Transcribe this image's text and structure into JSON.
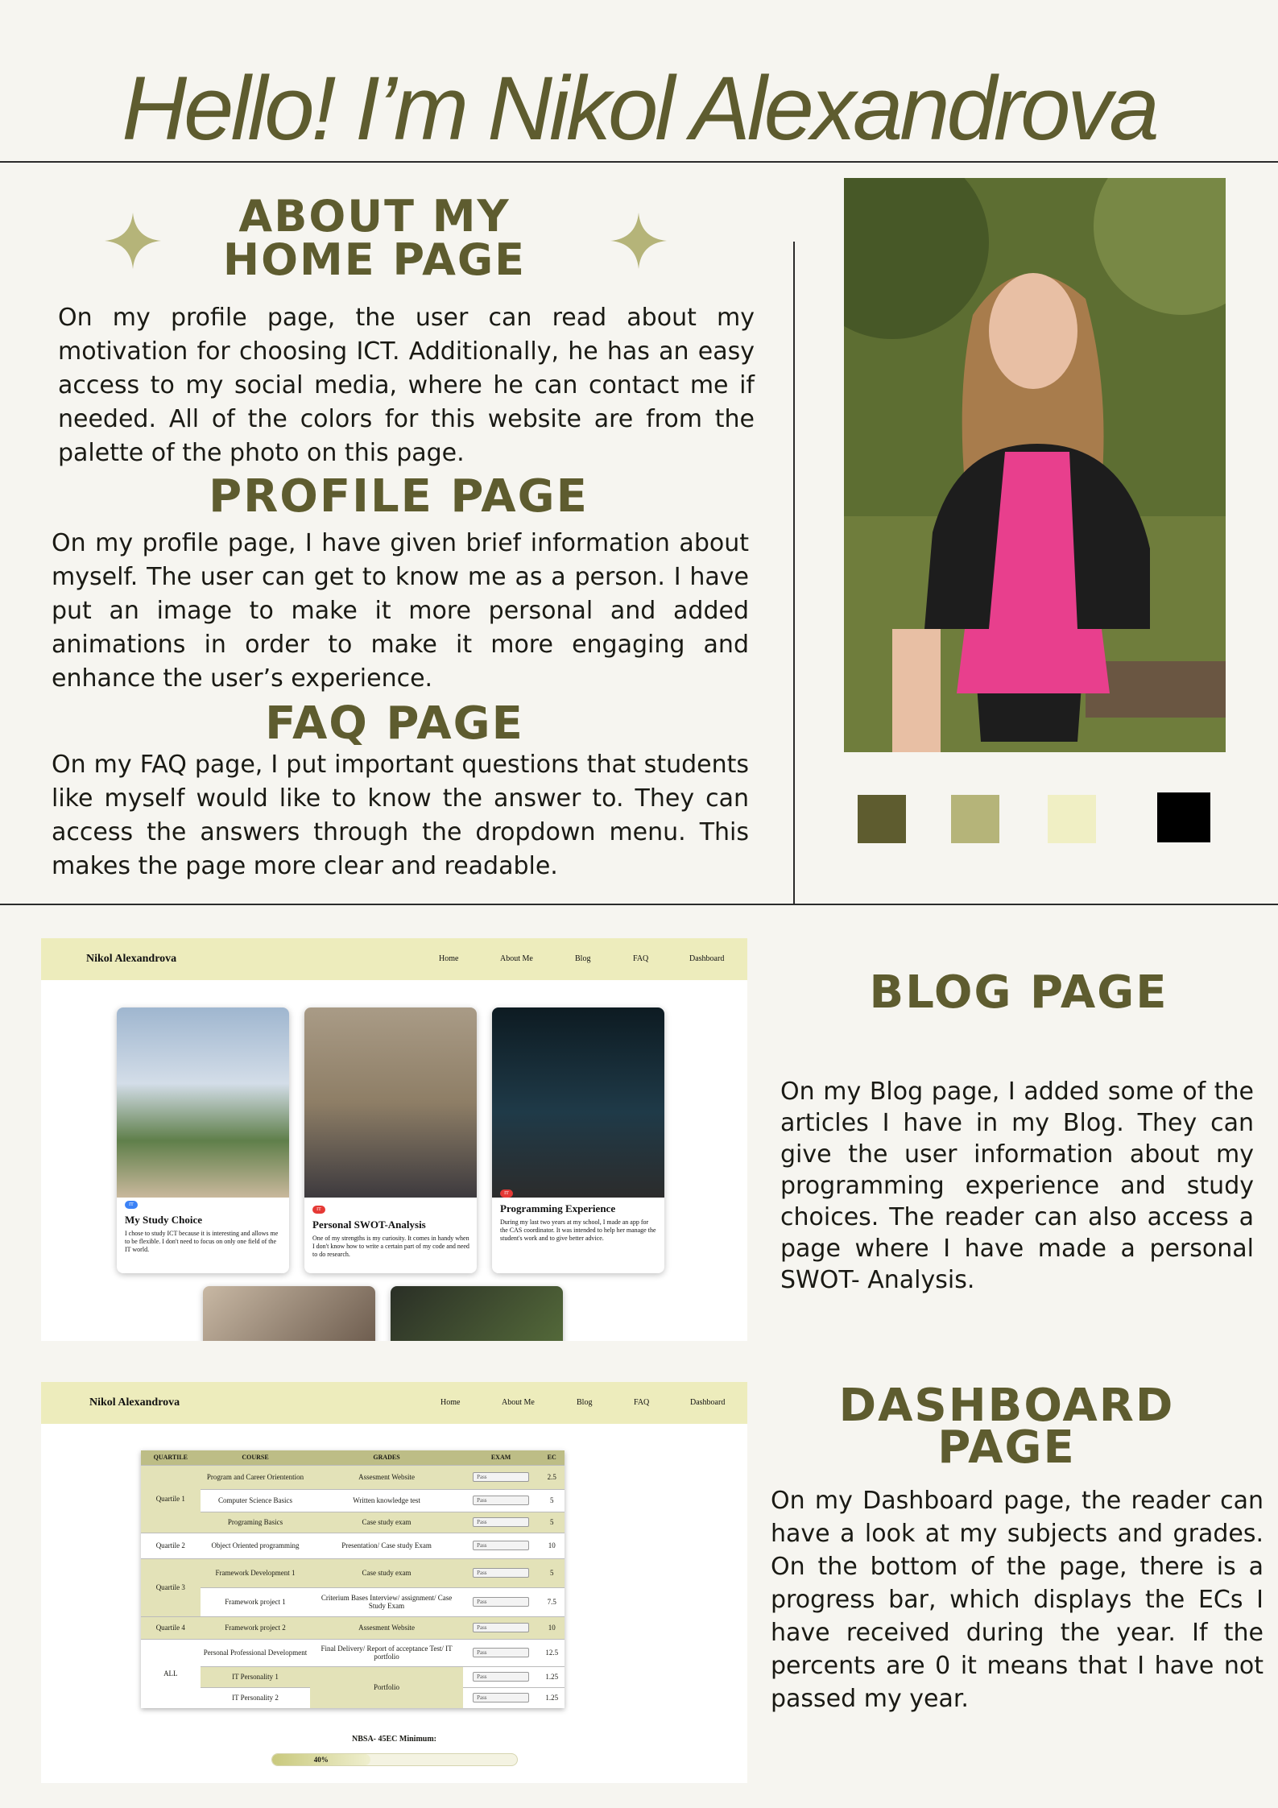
{
  "title": "Hello! I’m Nikol Alexandrova",
  "sections": {
    "about": {
      "heading_line1": "ABOUT MY",
      "heading_line2": "HOME PAGE",
      "text": "On my profile page, the user can read about my motivation for choosing ICT. Additionally, he has an easy access to my social media, where he can contact me if needed. All of the colors for this website are from the palette of the photo on this page."
    },
    "profile": {
      "heading": "PROFILE PAGE",
      "text": "On my profile page, I have given brief information about myself. The user can get to know me as a person. I have put an image to make it more personal and added animations in order to make it more engaging and enhance the user’s experience."
    },
    "faq": {
      "heading": "FAQ PAGE",
      "text": "On my FAQ page, I put important questions that students like myself would like to know the answer to. They can access the answers through the dropdown menu. This makes the page more clear and readable."
    },
    "blog": {
      "heading": "BLOG PAGE",
      "text": "On my Blog page, I added some of the articles I have in my Blog. They can give the user information about my programming experience and study choices. The reader can also access a page where I have made a personal SWOT- Analysis."
    },
    "dashboard": {
      "heading_line1": "DASHBOARD",
      "heading_line2": "PAGE",
      "text": "On my Dashboard page, the reader can have a look at my subjects and grades. On the bottom of the page, there is a progress bar, which displays the ECs I have received during the year. If the percents are 0 it means that I have not passed my year."
    }
  },
  "palette": [
    "#5e5c2f",
    "#b5b479",
    "#f0efc4",
    "#000000"
  ],
  "mockup_nav": {
    "brand": "Nikol Alexandrova",
    "links": [
      "Home",
      "About Me",
      "Blog",
      "FAQ",
      "Dashboard"
    ]
  },
  "blog_cards": [
    {
      "tag": "IT",
      "tag_color": "#3b82f6",
      "title": "My Study Choice",
      "text": "I chose to study ICT because it is interesting and allows me to be flexible. I don't need to focus on only one field of the IT world."
    },
    {
      "tag": "IT",
      "tag_color": "#e53935",
      "title": "Personal SWOT-Analysis",
      "text": "One of my strengths is my curiosity. It comes in handy when I don't know how to write a certain part of my code and need to do research."
    },
    {
      "tag": "IT",
      "tag_color": "#e53935",
      "title": "Programming Experience",
      "text": "During my last two years at my school, I made an app for the CAS coordinator. It was intended to help her manage the student's work and to give better advice."
    }
  ],
  "grades_table": {
    "headers": [
      "QUARTILE",
      "COURSE",
      "GRADES",
      "EXAM",
      "EC"
    ],
    "select_value": "Pass",
    "rows": [
      {
        "quartile": "Quartile 1",
        "course": "Program and Career Orientention",
        "grade": "Assesment Website",
        "ec": "2.5"
      },
      {
        "quartile": "",
        "course": "Computer Science Basics",
        "grade": "Written knowledge test",
        "ec": "5"
      },
      {
        "quartile": "",
        "course": "Programing Basics",
        "grade": "Case study exam",
        "ec": "5"
      },
      {
        "quartile": "Quartile 2",
        "course": "Object Oriented programming",
        "grade": "Presentation/ Case study Exam",
        "ec": "10"
      },
      {
        "quartile": "Quartile 3",
        "course": "Framework Development 1",
        "grade": "Case study exam",
        "ec": "5"
      },
      {
        "quartile": "",
        "course": "Framework project 1",
        "grade": "Criterium Bases Interview/ assignment/ Case Study Exam",
        "ec": "7.5"
      },
      {
        "quartile": "Quartile 4",
        "course": "Framework project 2",
        "grade": "Assesment Website",
        "ec": "10"
      },
      {
        "quartile": "ALL",
        "course": "Personal Professional Development",
        "grade": "Final Delivery/ Report of acceptance Test/ IT portfolio",
        "ec": "12.5"
      },
      {
        "quartile": "",
        "course": "IT Personality 1",
        "grade": "Portfolio",
        "ec": "1.25"
      },
      {
        "quartile": "",
        "course": "IT Personality 2",
        "grade": "",
        "ec": "1.25"
      }
    ],
    "nbsa_label": "NBSA- 45EC Minimum:",
    "progress_label": "40%",
    "progress": 0.4
  }
}
